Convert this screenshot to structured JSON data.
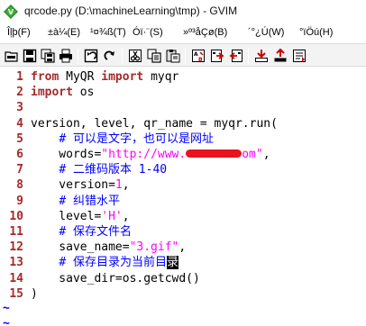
{
  "window": {
    "title": "qrcode.py (D:\\machineLearning\\tmp) - GVIM",
    "app_icon": "gvim-icon"
  },
  "menubar": {
    "items": [
      "Îļþ(F)",
      "±à¼­(E)",
      "¹¤¾ß(T)",
      "Óï·¨(S)",
      "»º³åÇø(B)",
      "´°¿Ú(W)",
      "°ïÖú(H)"
    ]
  },
  "toolbar": {
    "icons": [
      "open-folder-icon",
      "save-icon",
      "save-all-icon",
      "print-icon",
      "undo-icon",
      "redo-icon",
      "cut-icon",
      "copy-icon",
      "paste-icon",
      "find-replace-icon",
      "find-next-icon",
      "find-prev-icon",
      "load-session-icon",
      "save-session-icon",
      "run-script-icon"
    ]
  },
  "editor": {
    "lines": [
      {
        "n": "1",
        "parts": [
          [
            "kw",
            "from"
          ],
          [
            "",
            " MyQR "
          ],
          [
            "kw",
            "import"
          ],
          [
            "",
            " myqr"
          ]
        ]
      },
      {
        "n": "2",
        "parts": [
          [
            "kw",
            "import"
          ],
          [
            "",
            " os"
          ]
        ]
      },
      {
        "n": "3",
        "parts": []
      },
      {
        "n": "4",
        "parts": [
          [
            "",
            "version, level, qr_name = myqr.run("
          ]
        ]
      },
      {
        "n": "5",
        "parts": [
          [
            "",
            "    "
          ],
          [
            "cm",
            "# 可以是文字，也可以是网址"
          ]
        ]
      },
      {
        "n": "6",
        "parts": [
          [
            "",
            "    words="
          ],
          [
            "str",
            "\"http://www."
          ],
          [
            "redact",
            ""
          ],
          [
            "str",
            "om\""
          ],
          [
            "",
            ","
          ]
        ]
      },
      {
        "n": "7",
        "parts": [
          [
            "",
            "    "
          ],
          [
            "cm",
            "# 二维码版本 1-40"
          ]
        ]
      },
      {
        "n": "8",
        "parts": [
          [
            "",
            "    version="
          ],
          [
            "num",
            "1"
          ],
          [
            "",
            ","
          ]
        ]
      },
      {
        "n": "9",
        "parts": [
          [
            "",
            "    "
          ],
          [
            "cm",
            "# 纠错水平"
          ]
        ]
      },
      {
        "n": "10",
        "parts": [
          [
            "",
            "    level="
          ],
          [
            "str",
            "'H'"
          ],
          [
            "",
            ","
          ]
        ]
      },
      {
        "n": "11",
        "parts": [
          [
            "",
            "    "
          ],
          [
            "cm",
            "# 保存文件名"
          ]
        ]
      },
      {
        "n": "12",
        "parts": [
          [
            "",
            "    save_name="
          ],
          [
            "str",
            "\"3.gif\""
          ],
          [
            "",
            ","
          ]
        ]
      },
      {
        "n": "13",
        "parts": [
          [
            "",
            "    "
          ],
          [
            "cm",
            "# 保存目录为当前目"
          ],
          [
            "cursor",
            "录"
          ]
        ]
      },
      {
        "n": "14",
        "parts": [
          [
            "",
            "    save_dir=os.getcwd()"
          ]
        ]
      },
      {
        "n": "15",
        "parts": [
          [
            "",
            ")"
          ]
        ]
      }
    ],
    "empty_markers": [
      "~",
      "~"
    ]
  },
  "colors": {
    "line_number": "#a52a2a",
    "keyword": "#a52a2a",
    "comment": "#0000ff",
    "string": "#ff00ff",
    "redaction": "#e8141e"
  }
}
